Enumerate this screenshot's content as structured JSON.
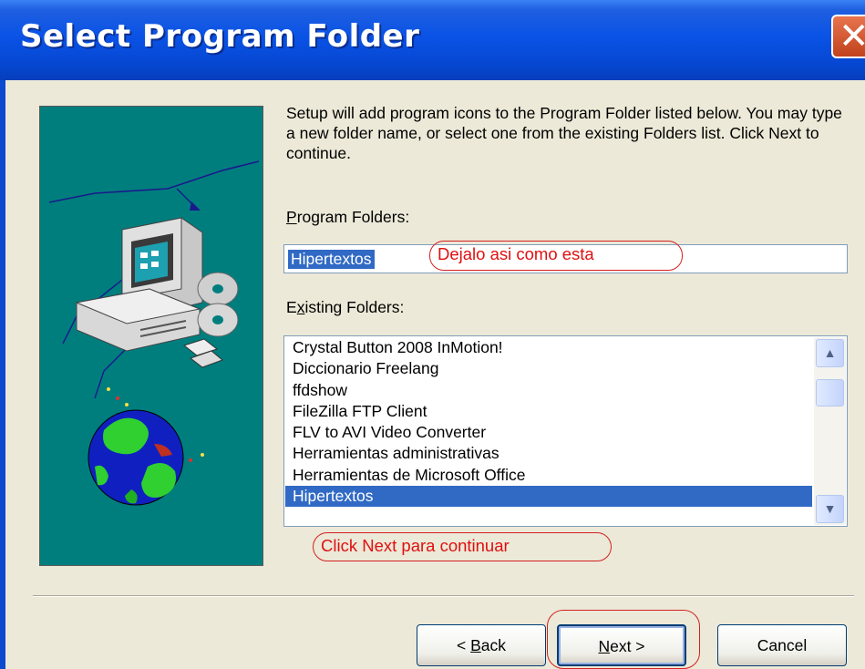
{
  "window": {
    "title": "Select Program Folder",
    "close_glyph": "✕"
  },
  "description": "Setup will add program icons to the Program Folder listed below. You may type a new folder name, or select one from the existing Folders list.  Click Next to continue.",
  "program_folders": {
    "label_accel": "P",
    "label_rest": "rogram Folders:",
    "value": "Hipertextos"
  },
  "existing_folders": {
    "label_pre": "E",
    "label_accel": "x",
    "label_rest": "isting Folders:",
    "items": [
      "Crystal Button 2008 InMotion!",
      "Diccionario Freelang",
      "ffdshow",
      "FileZilla FTP Client",
      "FLV to AVI Video Converter",
      "Herramientas administrativas",
      "Herramientas de Microsoft Office",
      "Hipertextos"
    ],
    "selected_index": 7,
    "scroll_up_glyph": "▲",
    "scroll_down_glyph": "▼"
  },
  "annotations": {
    "program_note": "Dejalo asi como esta",
    "next_note": "Click Next para continuar"
  },
  "buttons": {
    "back_pre": "< ",
    "back_accel": "B",
    "back_rest": "ack",
    "next_accel": "N",
    "next_rest": "ext >",
    "cancel": "Cancel"
  },
  "colors": {
    "title_bar": "#0A53E6",
    "selection": "#316AC5",
    "annotation": "#E01010",
    "art_background": "#007E7E"
  }
}
